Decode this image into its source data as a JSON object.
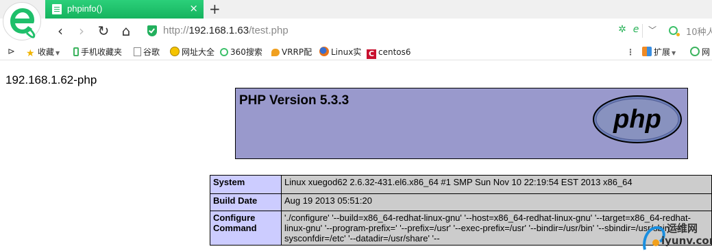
{
  "tab": {
    "title": "phpinfo()",
    "close": "×"
  },
  "newtab": "+",
  "nav": {
    "back": "‹",
    "forward": "›",
    "reload": "↻",
    "home": "⌂"
  },
  "url": {
    "scheme": "http://",
    "host": "192.168.1.63",
    "path": "/test.php"
  },
  "search": {
    "text": "10种人"
  },
  "bookmarks": {
    "items": [
      {
        "label": "收藏",
        "icon": "star-icon"
      },
      {
        "label": "手机收藏夹",
        "icon": "phone-icon"
      },
      {
        "label": "谷歌",
        "icon": "page-icon"
      },
      {
        "label": "网址大全",
        "icon": "globe-icon"
      },
      {
        "label": "360搜索",
        "icon": "search360-icon"
      },
      {
        "label": "VRRP配",
        "icon": "leaf-icon"
      },
      {
        "label": "Linux实",
        "icon": "firefox-icon"
      },
      {
        "label": "centos6",
        "icon": "c-icon"
      }
    ],
    "extensions": "扩展",
    "extra": "网"
  },
  "page": {
    "server_note": "192.168.1.62-php",
    "php_version": "PHP Version 5.3.3",
    "logo_text": "php",
    "rows": [
      {
        "key": "System",
        "value": "Linux xuegod62 2.6.32-431.el6.x86_64 #1 SMP Sun Nov 10 22:19:54 EST 2013 x86_64"
      },
      {
        "key": "Build Date",
        "value": "Aug 19 2013 05:51:20"
      },
      {
        "key": "Configure Command",
        "value": "'./configure' '--build=x86_64-redhat-linux-gnu' '--host=x86_64-redhat-linux-gnu' '--target=x86_64-redhat-linux-gnu' '--program-prefix=' '--prefix=/usr' '--exec-prefix=/usr' '--bindir=/usr/bin' '--sbindir=/usr/sbin' '--sysconfdir=/etc' '--datadir=/usr/share' '--"
      }
    ]
  },
  "watermark": {
    "cn": "运维网",
    "en": "iyunv.com"
  },
  "colors": {
    "tab_green": "#16b35e",
    "php_header": "#9999cc",
    "key_cell": "#ccccff",
    "value_cell": "#cccccc"
  }
}
